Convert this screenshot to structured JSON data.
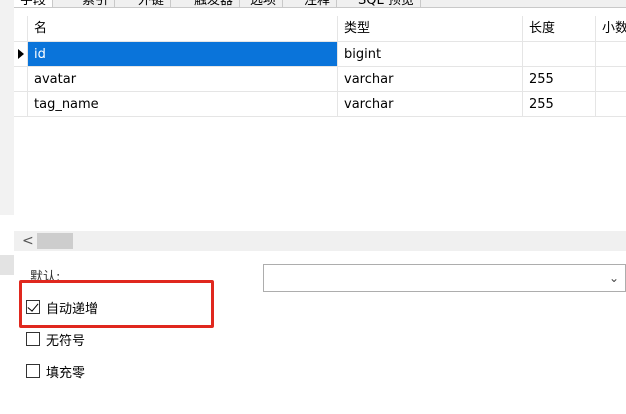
{
  "tabs": [
    "字段",
    "索引",
    "外键",
    "触发器",
    "选项",
    "注释",
    "SQL 预览"
  ],
  "grid": {
    "columns": [
      "名",
      "类型",
      "长度",
      "小数点"
    ],
    "rows": [
      {
        "name": "id",
        "type": "bigint",
        "length": "",
        "decimals": ""
      },
      {
        "name": "avatar",
        "type": "varchar",
        "length": "255",
        "decimals": ""
      },
      {
        "name": "tag_name",
        "type": "varchar",
        "length": "255",
        "decimals": ""
      }
    ]
  },
  "scrollbar": {
    "left_arrow": "<"
  },
  "properties": {
    "default_label": "默认:",
    "default_value": "",
    "chevron": "⌄",
    "checkboxes": [
      {
        "label": "自动递增",
        "checked": true
      },
      {
        "label": "无符号",
        "checked": false
      },
      {
        "label": "填充零",
        "checked": false
      }
    ]
  },
  "colors": {
    "selection": "#0a74da",
    "highlight": "#e0281e"
  }
}
